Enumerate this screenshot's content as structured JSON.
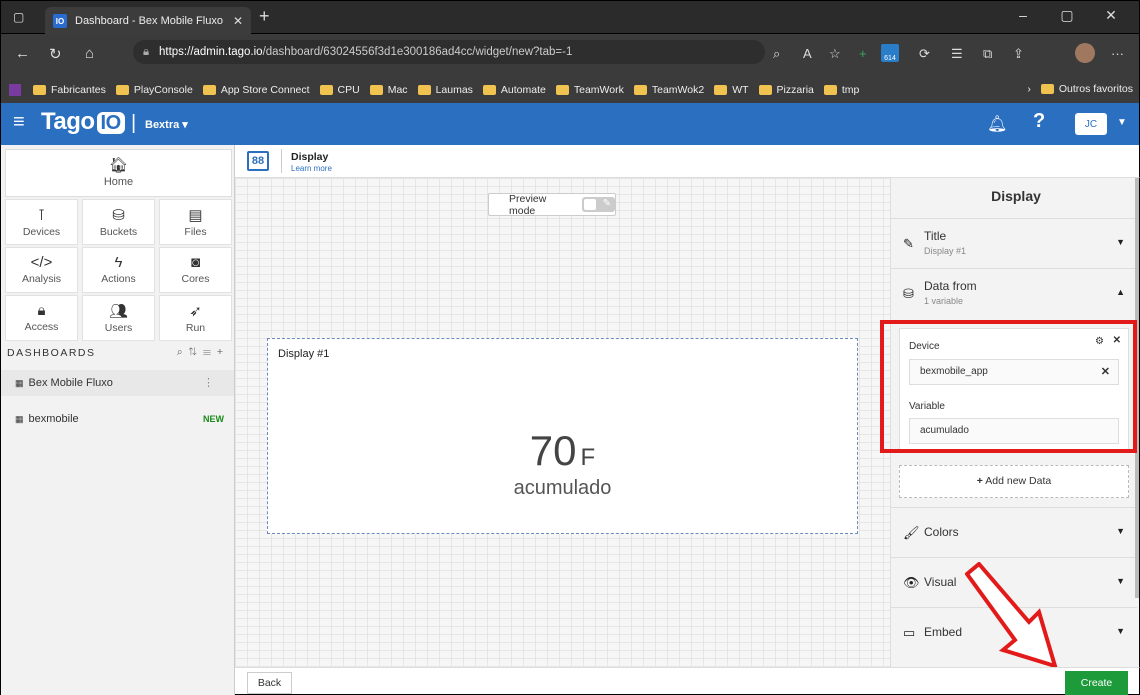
{
  "browser": {
    "tab_title": "Dashboard - Bex Mobile Fluxo",
    "tab_favicon": "IO",
    "url_host": "https://admin.tago.io",
    "url_path": "/dashboard/63024556f3d1e300186ad4cc/widget/new?tab=-1",
    "badge": "614",
    "bookmarks": [
      "Fabricantes",
      "PlayConsole",
      "App Store Connect",
      "CPU",
      "Mac",
      "Laumas",
      "Automate",
      "TeamWork",
      "TeamWok2",
      "WT",
      "Pizzaria",
      "tmp"
    ],
    "bookmarks_other": "Outros favoritos"
  },
  "header": {
    "logo_text": "Tago",
    "logo_io": "IO",
    "profile": "Bextra ▾",
    "user_initials": "JC"
  },
  "sidebar": {
    "home_label": "Home",
    "tiles": [
      {
        "label": "Devices",
        "icon": "device-icon"
      },
      {
        "label": "Buckets",
        "icon": "bucket-icon"
      },
      {
        "label": "Files",
        "icon": "files-icon"
      },
      {
        "label": "Analysis",
        "icon": "code-icon"
      },
      {
        "label": "Actions",
        "icon": "bolt-icon"
      },
      {
        "label": "Cores",
        "icon": "core-icon"
      },
      {
        "label": "Access",
        "icon": "lock-icon"
      },
      {
        "label": "Users",
        "icon": "users-icon"
      },
      {
        "label": "Run",
        "icon": "rocket-icon"
      }
    ],
    "dashboards_heading": "DASHBOARDS",
    "dashboards": [
      {
        "label": "Bex Mobile Fluxo"
      },
      {
        "label": "bexmobile",
        "badge": "NEW"
      }
    ]
  },
  "widget_header": {
    "title": "Display",
    "learn_more": "Learn more",
    "icon_text": "88"
  },
  "canvas": {
    "preview_label": "Preview mode",
    "widget_title": "Display #1",
    "value": "70",
    "unit": "F",
    "variable_label": "acumulado"
  },
  "panel": {
    "title": "Display",
    "sections": {
      "title": {
        "label": "Title",
        "sub": "Display #1"
      },
      "data_from": {
        "label": "Data from",
        "sub": "1 variable"
      },
      "colors": {
        "label": "Colors"
      },
      "visual": {
        "label": "Visual"
      },
      "embed": {
        "label": "Embed"
      }
    },
    "data_card": {
      "device_label": "Device",
      "device_value": "bexmobile_app",
      "variable_label": "Variable",
      "variable_value": "acumulado"
    },
    "add_data": "Add new Data"
  },
  "footer": {
    "back": "Back",
    "create": "Create"
  },
  "colors": {
    "brand": "#2b6fc0",
    "create": "#1d9a3a",
    "highlight": "#e21a1a"
  }
}
